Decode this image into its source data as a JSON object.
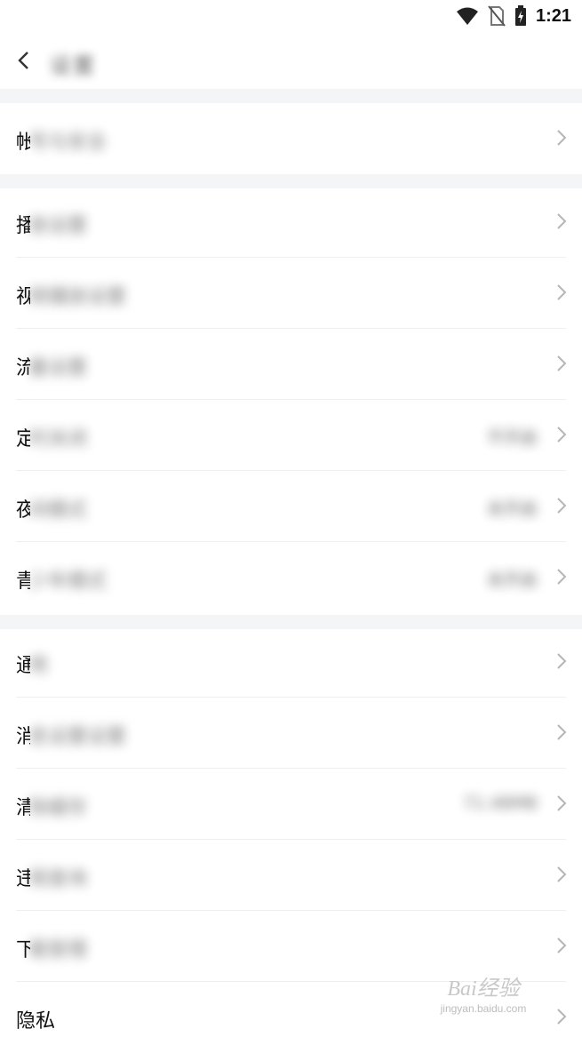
{
  "status_bar": {
    "time": "1:21",
    "icons": [
      "wifi-icon",
      "no-sim-icon",
      "battery-charging-icon"
    ]
  },
  "header": {
    "title": "设置"
  },
  "sections": [
    {
      "items": [
        {
          "label_first": "帐",
          "label_rest": "号与安全",
          "value": ""
        }
      ]
    },
    {
      "items": [
        {
          "label_first": "播",
          "label_rest": "放设置",
          "value": ""
        },
        {
          "label_first": "视",
          "label_rest": "频播放设置",
          "value": ""
        },
        {
          "label_first": "流",
          "label_rest": "量设置",
          "value": ""
        },
        {
          "label_first": "定",
          "label_rest": "时关闭",
          "value": "不开启"
        },
        {
          "label_first": "夜",
          "label_rest": "间模式",
          "value": "未开启"
        },
        {
          "label_first": "青",
          "label_rest": "少年模式",
          "value": "未开启"
        }
      ]
    },
    {
      "items": [
        {
          "label_first": "通",
          "label_rest": "用",
          "value": ""
        },
        {
          "label_first": "消",
          "label_rest": "息设置设置",
          "value": ""
        },
        {
          "label_first": "清",
          "label_rest": "除缓存",
          "value": "71.48MB"
        },
        {
          "label_first": "违",
          "label_rest": "规查询",
          "value": ""
        },
        {
          "label_first": "下",
          "label_rest": "载管理",
          "value": ""
        },
        {
          "label_first": "隐私",
          "label_rest": "",
          "value": ""
        }
      ]
    }
  ],
  "watermark": {
    "brand": "Bai经验",
    "url": "jingyan.baidu.com"
  }
}
